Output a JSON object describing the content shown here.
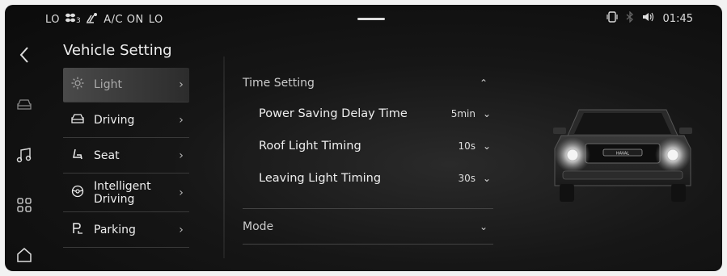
{
  "status": {
    "temp_left": "LO",
    "fan_level": "3",
    "ac": "A/C ON",
    "temp_right": "LO",
    "time": "01:45"
  },
  "rail": {
    "icons": [
      "back-icon",
      "car-icon",
      "music-icon",
      "apps-icon",
      "home-icon"
    ]
  },
  "menu": {
    "title": "Vehicle Setting",
    "items": [
      {
        "label": "Light",
        "icon": "sun-icon",
        "active": true
      },
      {
        "label": "Driving",
        "icon": "car-icon"
      },
      {
        "label": "Seat",
        "icon": "seat-icon"
      },
      {
        "label": "Intelligent Driving",
        "icon": "steering-icon"
      },
      {
        "label": "Parking",
        "icon": "parking-icon"
      }
    ]
  },
  "content": {
    "time_setting": {
      "label": "Time Setting",
      "rows": [
        {
          "label": "Power Saving Delay Time",
          "value": "5min"
        },
        {
          "label": "Roof Light Timing",
          "value": "10s"
        },
        {
          "label": "Leaving Light Timing",
          "value": "30s"
        }
      ]
    },
    "mode": {
      "label": "Mode"
    }
  },
  "car": {
    "badge": "HAVAL"
  },
  "colors": {
    "background": "#111111",
    "text": "#e6e6e6",
    "divider": "#444444"
  }
}
